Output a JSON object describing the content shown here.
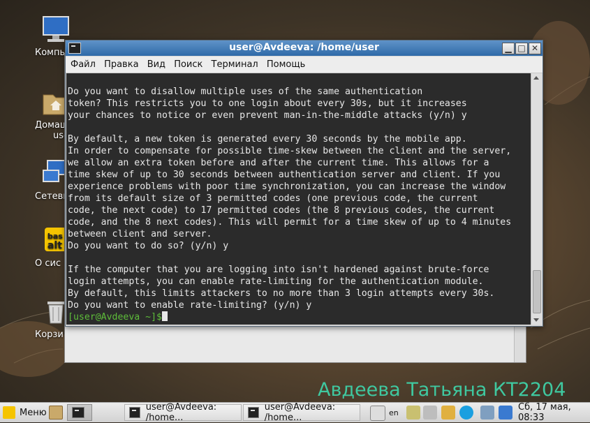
{
  "desktop": {
    "icons": [
      {
        "label": "Компь",
        "icon": "computer-icon"
      },
      {
        "label": "Домашн",
        "label2": "use",
        "icon": "home-folder-icon"
      },
      {
        "label": "Сетевые",
        "icon": "network-icon"
      },
      {
        "label": "О сис",
        "icon": "about-system-icon"
      },
      {
        "label": "Корзи",
        "icon": "trash-icon"
      }
    ],
    "watermark": "Авдеева Татьяна КТ2204"
  },
  "window": {
    "title": "user@Avdeeva: /home/user",
    "buttons": {
      "minimize": "▁",
      "maximize": "□",
      "close": "✕"
    },
    "menu": [
      "Файл",
      "Правка",
      "Вид",
      "Поиск",
      "Терминал",
      "Помощь"
    ]
  },
  "terminal": {
    "lines": "Do you want to disallow multiple uses of the same authentication\ntoken? This restricts you to one login about every 30s, but it increases\nyour chances to notice or even prevent man-in-the-middle attacks (y/n) y\n\nBy default, a new token is generated every 30 seconds by the mobile app.\nIn order to compensate for possible time-skew between the client and the server,\nwe allow an extra token before and after the current time. This allows for a\ntime skew of up to 30 seconds between authentication server and client. If you\nexperience problems with poor time synchronization, you can increase the window\nfrom its default size of 3 permitted codes (one previous code, the current\ncode, the next code) to 17 permitted codes (the 8 previous codes, the current\ncode, and the 8 next codes). This will permit for a time skew of up to 4 minutes\nbetween client and server.\nDo you want to do so? (y/n) y\n\nIf the computer that you are logging into isn't hardened against brute-force\nlogin attempts, you can enable rate-limiting for the authentication module.\nBy default, this limits attackers to no more than 3 login attempts every 30s.\nDo you want to enable rate-limiting? (y/n) y",
    "prompt": "[user@Avdeeva ~]$"
  },
  "taskbar": {
    "menu_label": "Меню",
    "tasks": [
      "user@Avdeeva: /home...",
      "user@Avdeeva: /home..."
    ],
    "language": "en",
    "clock": "Сб, 17 мая, 08:33"
  }
}
